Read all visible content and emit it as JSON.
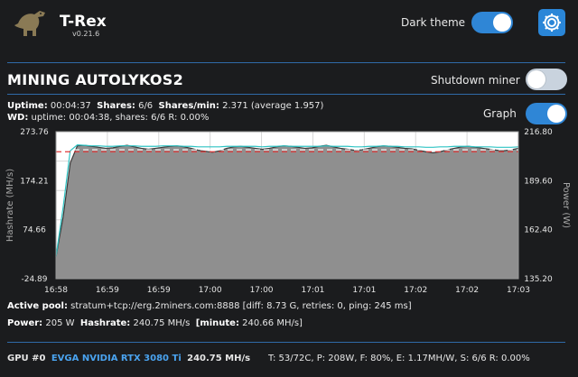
{
  "header": {
    "app_title": "T-Rex",
    "version": "v0.21.6",
    "dark_theme_label": "Dark theme",
    "dark_theme_on": true,
    "settings_icon": "gear-icon"
  },
  "miner": {
    "title": "MINING AUTOLYKOS2",
    "shutdown_label": "Shutdown miner",
    "shutdown_on": false,
    "graph_label": "Graph",
    "graph_on": true
  },
  "stats": {
    "uptime_label": "Uptime:",
    "uptime_value": "00:04:37",
    "shares_label": "Shares:",
    "shares_value": "6/6",
    "shares_min_label": "Shares/min:",
    "shares_min_value": "2.371 (average 1.957)",
    "wd_label": "WD:",
    "wd_value": "uptime: 00:04:38, shares: 6/6  R: 0.00%"
  },
  "chart_data": {
    "type": "line",
    "ylabel": "Hashrate (MH/s)",
    "y2label": "Power (W)",
    "ylim": [
      -24.89,
      273.76
    ],
    "y2lim": [
      135.2,
      216.8
    ],
    "y_ticks": [
      "273.76",
      "174.21",
      "74.66",
      "-24.89"
    ],
    "y2_ticks": [
      "216.80",
      "189.60",
      "162.40",
      "135.20"
    ],
    "x_ticks": [
      "16:58",
      "16:59",
      "16:59",
      "17:00",
      "17:00",
      "17:01",
      "17:01",
      "17:02",
      "17:02",
      "17:03"
    ],
    "series": [
      {
        "color": "#b8b8b8",
        "values": [
          20,
          100,
          210,
          245,
          246,
          244,
          242,
          240,
          241,
          244,
          246,
          243,
          240,
          238,
          240,
          242,
          244,
          245,
          243,
          240,
          236,
          234,
          232,
          235,
          240,
          243,
          244,
          242,
          240,
          238,
          240,
          243,
          245,
          244,
          242,
          240,
          241,
          244,
          246,
          243,
          240,
          238,
          236,
          237,
          240,
          243,
          245,
          244,
          242,
          240,
          239,
          236,
          233,
          231,
          233,
          237,
          240,
          243,
          244,
          242,
          240,
          238,
          236,
          235,
          237,
          240
        ]
      },
      {
        "color": "#2ec4c4",
        "values": [
          20,
          120,
          235,
          247,
          246,
          245,
          245,
          244,
          244,
          245,
          245,
          245,
          244,
          244,
          244,
          245,
          245,
          245,
          244,
          244,
          243,
          243,
          243,
          243,
          244,
          244,
          244,
          244,
          244,
          243,
          244,
          244,
          245,
          244,
          244,
          244,
          244,
          244,
          245,
          244,
          244,
          244,
          243,
          243,
          244,
          244,
          245,
          244,
          244,
          243,
          243,
          243,
          242,
          242,
          243,
          243,
          244,
          244,
          244,
          243,
          243,
          243,
          242,
          242,
          242,
          243
        ]
      }
    ],
    "reference_lines": [
      {
        "color": "#ffffff",
        "style": "dashed",
        "value": 237
      },
      {
        "color": "#e03a3a",
        "style": "dashed",
        "value": 233
      }
    ]
  },
  "pool": {
    "label": "Active pool:",
    "value": "stratum+tcp://erg.2miners.com:8888  [diff: 8.73 G, retries: 0, ping: 245 ms]"
  },
  "power_line": {
    "power_label": "Power:",
    "power_value": "205 W",
    "hashrate_label": "Hashrate:",
    "hashrate_value": "240.75 MH/s",
    "minute_label": "[minute:",
    "minute_value": "240.66 MH/s]"
  },
  "gpu": {
    "label": "GPU #0",
    "name": "EVGA NVIDIA RTX 3080 Ti",
    "hashrate": "240.75 MH/s",
    "details": "T: 53/72C, P: 208W, F: 80%, E: 1.17MH/W, S: 6/6  R: 0.00%"
  }
}
